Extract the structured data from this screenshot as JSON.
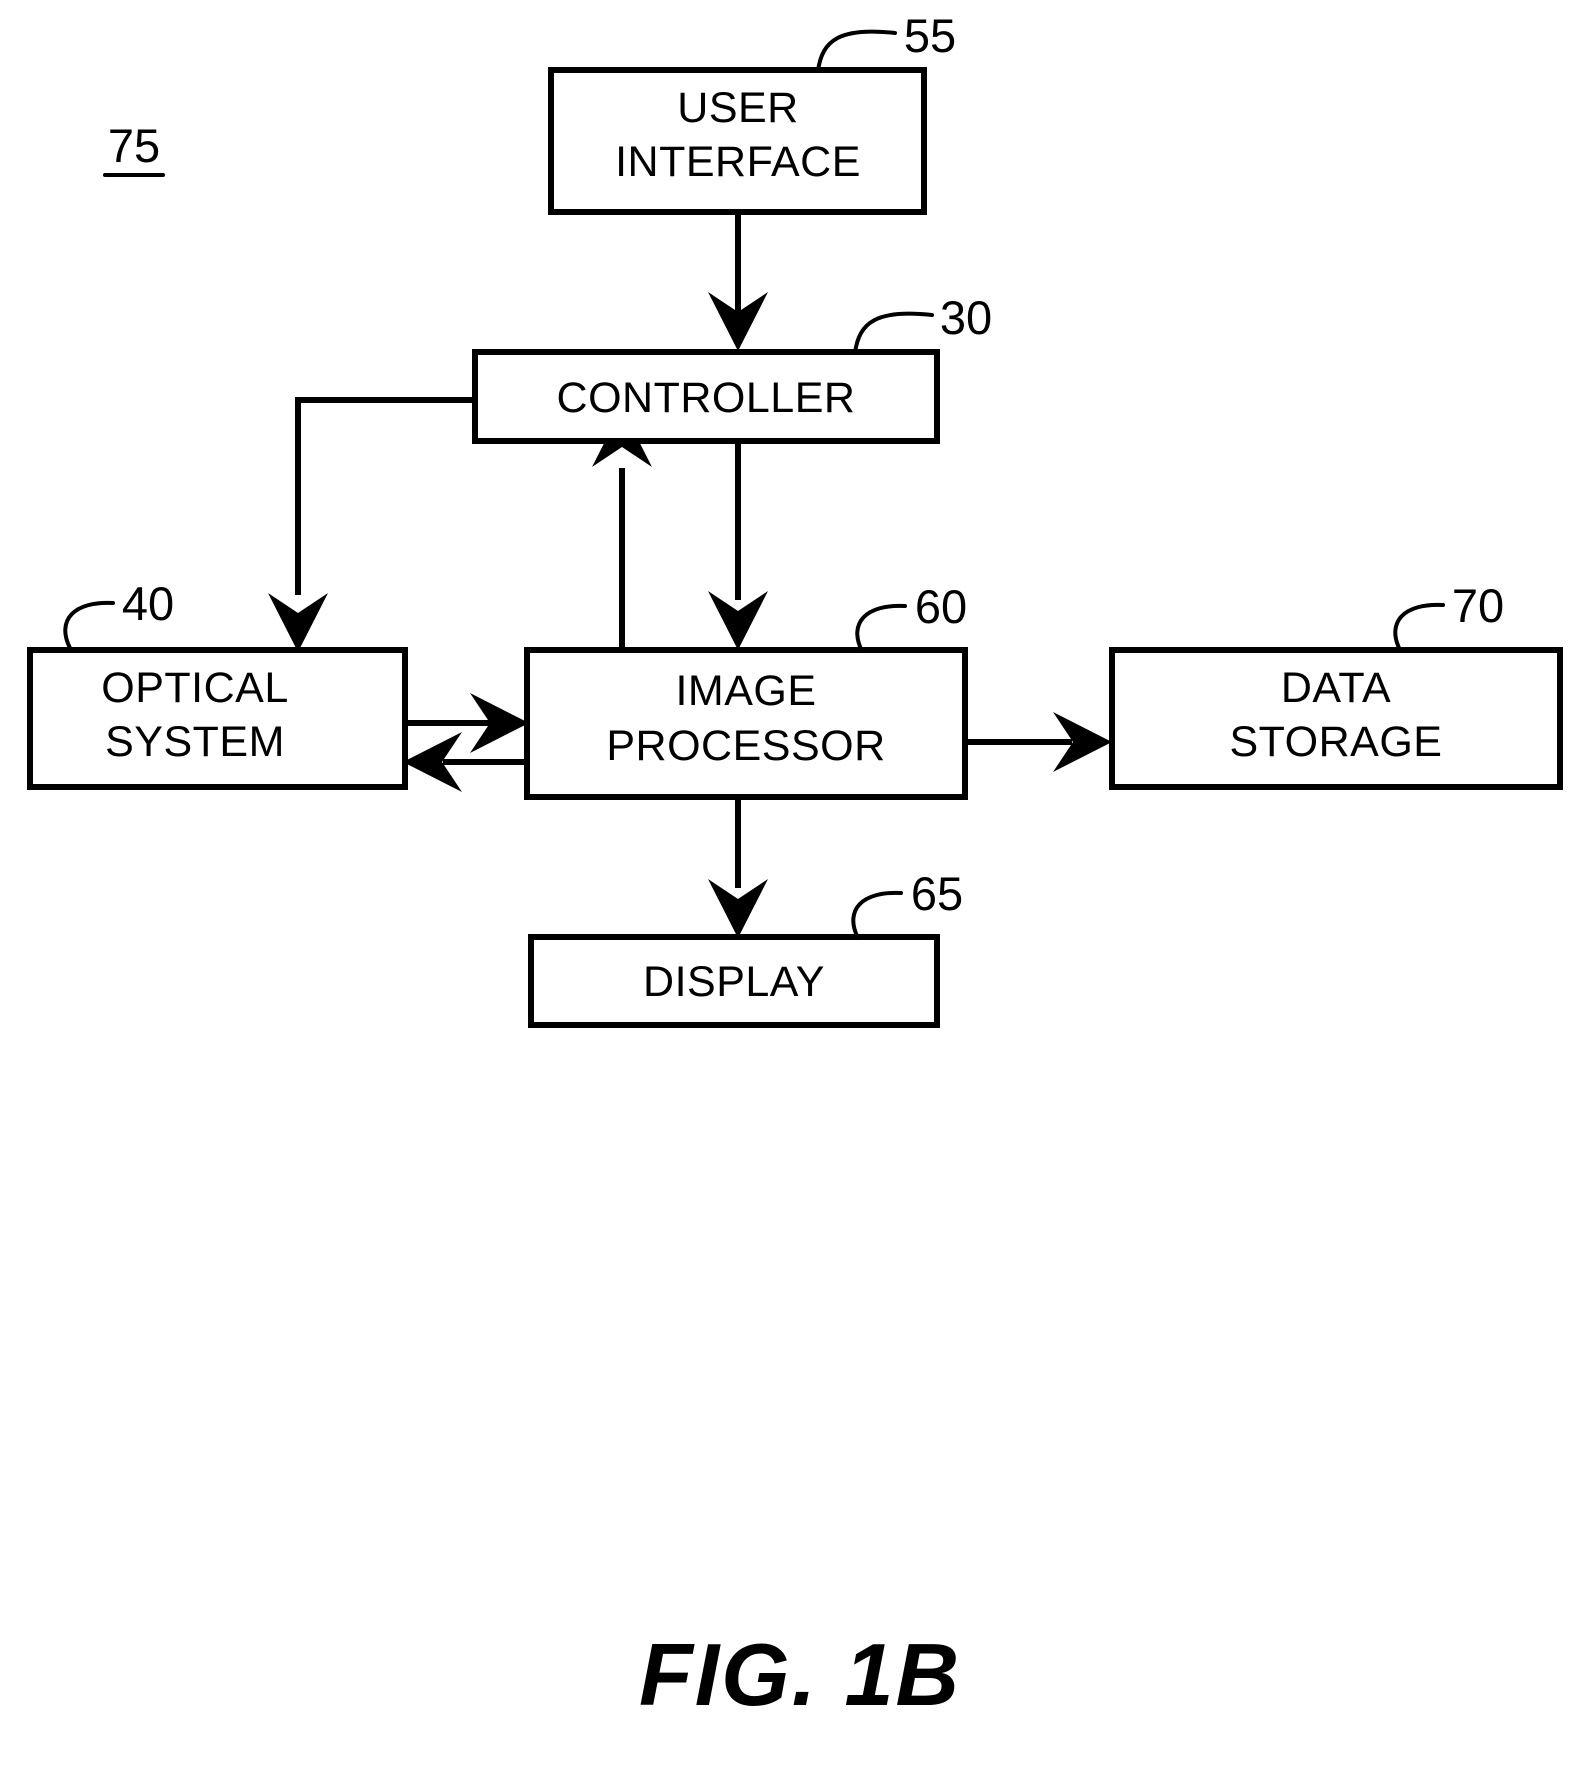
{
  "figure": {
    "caption": "FIG. 1B",
    "system_ref": "75"
  },
  "blocks": [
    {
      "id": "user-interface",
      "ref": "55",
      "lines": [
        "USER",
        "INTERFACE"
      ],
      "line1": "USER",
      "line2": "INTERFACE"
    },
    {
      "id": "controller",
      "ref": "30",
      "line1": "CONTROLLER",
      "line2": ""
    },
    {
      "id": "optical-system",
      "ref": "40",
      "line1": "OPTICAL",
      "line2": "SYSTEM"
    },
    {
      "id": "image-processor",
      "ref": "60",
      "line1": "IMAGE",
      "line2": "PROCESSOR"
    },
    {
      "id": "data-storage",
      "ref": "70",
      "line1": "DATA",
      "line2": "STORAGE"
    },
    {
      "id": "display",
      "ref": "65",
      "line1": "DISPLAY",
      "line2": ""
    }
  ],
  "connections": [
    {
      "from": "user-interface",
      "to": "controller",
      "direction": "down"
    },
    {
      "from": "controller",
      "to": "optical-system",
      "direction": "down-left"
    },
    {
      "from": "controller",
      "to": "image-processor",
      "direction": "down"
    },
    {
      "from": "image-processor",
      "to": "controller",
      "direction": "up"
    },
    {
      "from": "optical-system",
      "to": "image-processor",
      "direction": "right"
    },
    {
      "from": "image-processor",
      "to": "optical-system",
      "direction": "left"
    },
    {
      "from": "image-processor",
      "to": "data-storage",
      "direction": "right"
    },
    {
      "from": "image-processor",
      "to": "display",
      "direction": "down"
    }
  ],
  "colors": {
    "ink": "#000000",
    "paper": "#ffffff"
  }
}
